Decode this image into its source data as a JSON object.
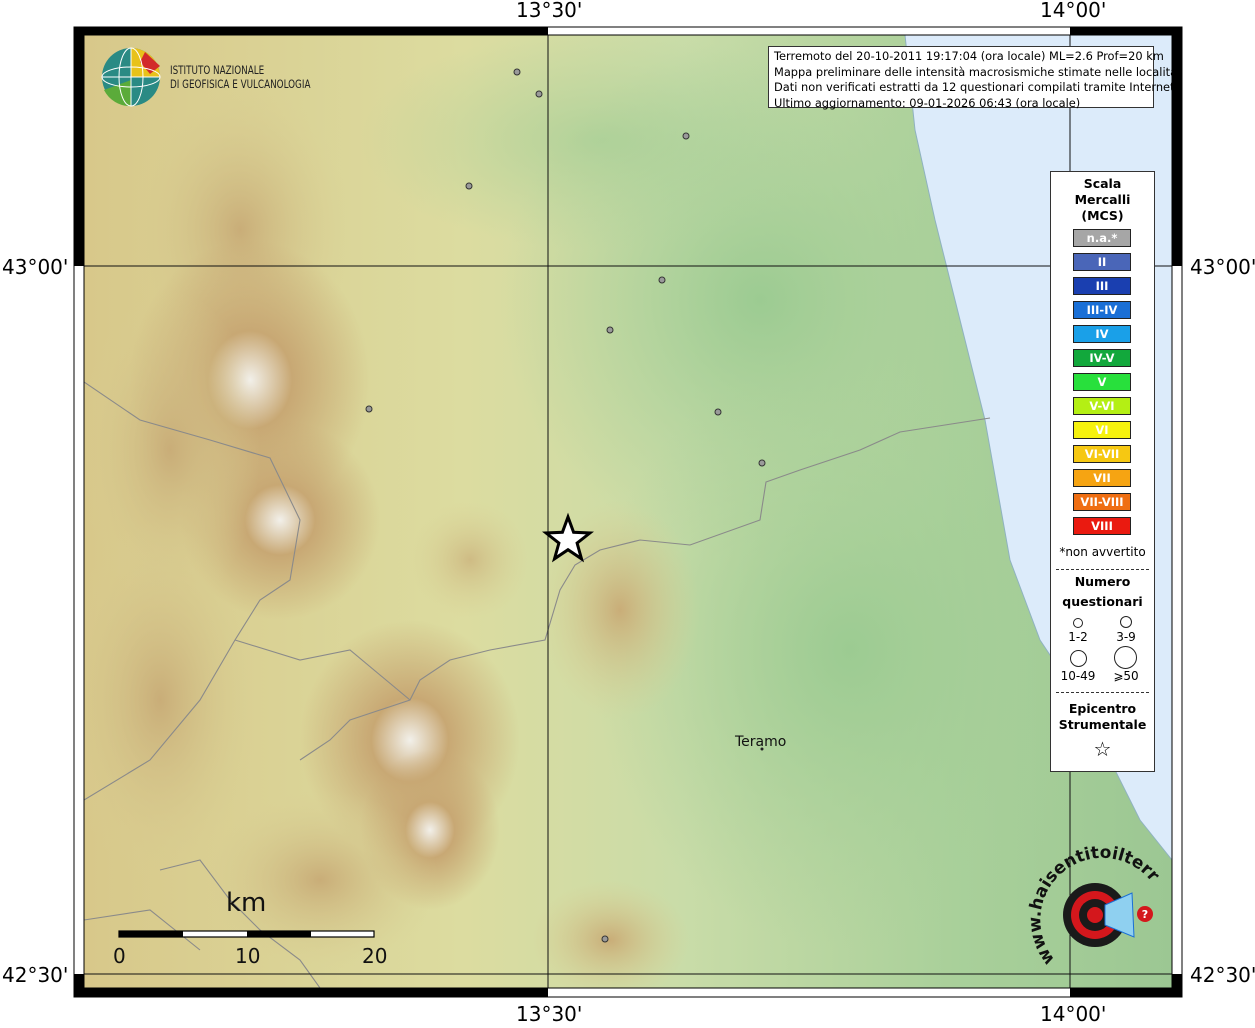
{
  "axes": {
    "top": [
      "13°30'",
      "14°00'"
    ],
    "bottom": [
      "13°30'",
      "14°00'"
    ],
    "left": [
      "43°00'",
      "42°30'"
    ],
    "right": [
      "43°00'",
      "42°30'"
    ]
  },
  "logo": {
    "line1": "ISTITUTO NAZIONALE",
    "line2": "DI GEOFISICA E VULCANOLOGIA"
  },
  "info": {
    "line1": "Terremoto del 20-10-2011 19:17:04 (ora locale) ML=2.6 Prof=20 km",
    "line2": "Mappa preliminare delle intensità macrosismiche stimate nelle località",
    "line3": "Dati non verificati estratti da 12 questionari compilati tramite Internet.",
    "line4": "Ultimo aggiornamento: 09-01-2026 06:43 (ora locale)"
  },
  "legend": {
    "title1": "Scala",
    "title2": "Mercalli",
    "title3": "(MCS)",
    "scale": [
      {
        "label": "n.a.*",
        "color": "#a6a6a6"
      },
      {
        "label": "II",
        "color": "#4a66b8"
      },
      {
        "label": "III",
        "color": "#1a3fb0"
      },
      {
        "label": "III-IV",
        "color": "#1a6fd6"
      },
      {
        "label": "IV",
        "color": "#1aa0e8"
      },
      {
        "label": "IV-V",
        "color": "#12a83c"
      },
      {
        "label": "V",
        "color": "#28e03c"
      },
      {
        "label": "V-VI",
        "color": "#b4ef14"
      },
      {
        "label": "VI",
        "color": "#f6f20e"
      },
      {
        "label": "VI-VII",
        "color": "#f6c812"
      },
      {
        "label": "VII",
        "color": "#f6a412"
      },
      {
        "label": "VII-VIII",
        "color": "#ef6e12"
      },
      {
        "label": "VIII",
        "color": "#ea1a10"
      }
    ],
    "non_felt_note": "*non avvertito",
    "count_title1": "Numero",
    "count_title2": "questionari",
    "count_labels": [
      "1-2",
      "3-9",
      "10-49",
      "⩾50"
    ],
    "epicenter_title1": "Epicentro",
    "epicenter_title2": "Strumentale",
    "epicenter_symbol": "☆"
  },
  "scale_bar": {
    "unit": "km",
    "ticks": [
      "0",
      "10",
      "20"
    ]
  },
  "places": {
    "teramo": "Teramo"
  },
  "brand": {
    "text": "haisentitoilterremoto.it",
    "www": "www.",
    "accent": "#d4171c"
  },
  "colors": {
    "sea": "#dcebfa",
    "lowland": "#b7d5a0",
    "midland": "#e8e2a8",
    "mountain": "#c4a06a",
    "peak": "#f2f2f2"
  }
}
